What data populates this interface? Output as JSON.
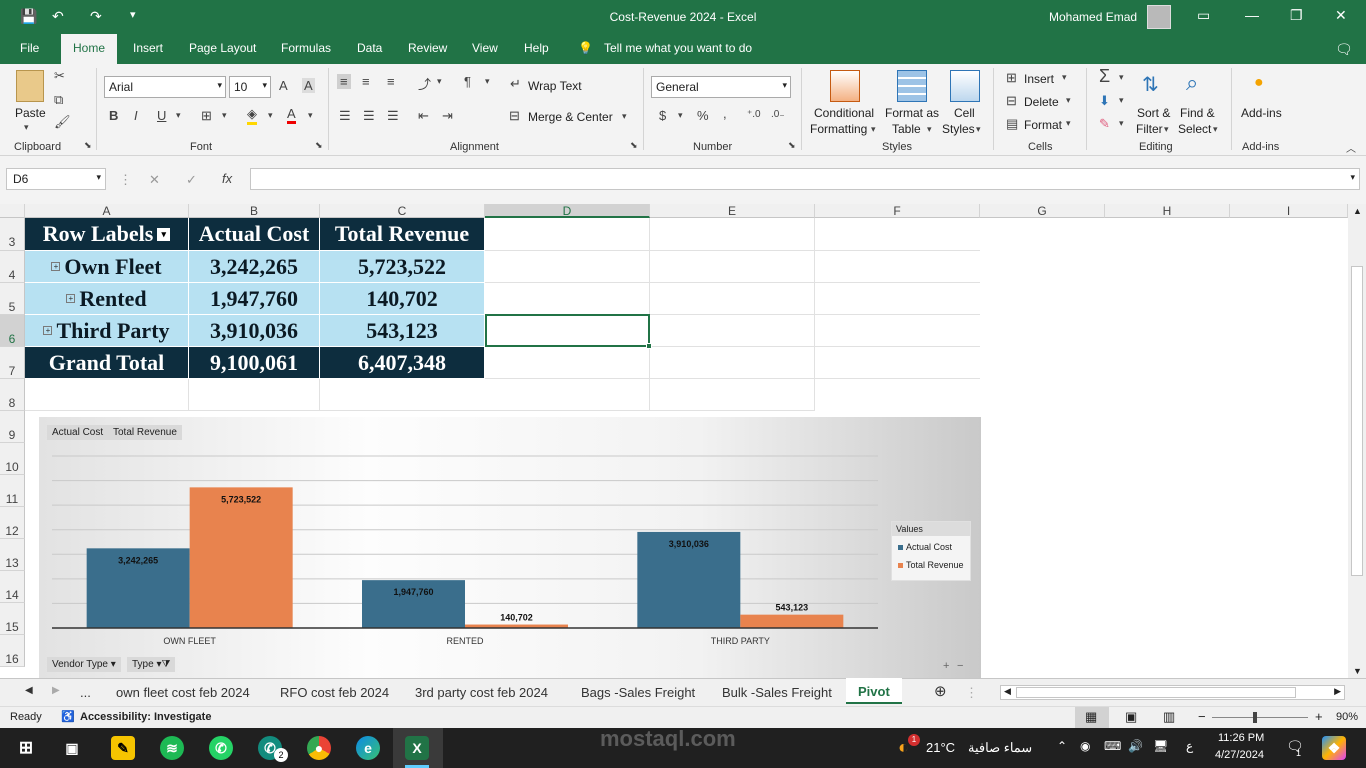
{
  "window": {
    "title": "Cost-Revenue 2024  -  Excel",
    "user_name": "Mohamed Emad"
  },
  "menu": {
    "tabs": [
      "File",
      "Home",
      "Insert",
      "Page Layout",
      "Formulas",
      "Data",
      "Review",
      "View",
      "Help"
    ],
    "active_tab": "Home",
    "tell_me": "Tell me what you want to do"
  },
  "ribbon": {
    "clipboard": {
      "paste": "Paste",
      "label": "Clipboard"
    },
    "font": {
      "name": "Arial",
      "size": "10",
      "label": "Font",
      "bold": "B",
      "italic": "I",
      "underline": "U"
    },
    "alignment": {
      "wrap_text": "Wrap Text",
      "merge_center": "Merge & Center",
      "label": "Alignment"
    },
    "number": {
      "format": "General",
      "label": "Number",
      "currency": "$",
      "percent": "%",
      "comma": ","
    },
    "styles": {
      "conditional_1": "Conditional",
      "conditional_2": "Formatting",
      "format_table_1": "Format as",
      "format_table_2": "Table",
      "cell_styles_1": "Cell",
      "cell_styles_2": "Styles",
      "label": "Styles"
    },
    "cells": {
      "insert": "Insert",
      "delete": "Delete",
      "format": "Format",
      "label": "Cells"
    },
    "editing": {
      "sort_1": "Sort &",
      "sort_2": "Filter",
      "find_1": "Find &",
      "find_2": "Select",
      "sum": "Σ",
      "label": "Editing"
    },
    "addins": {
      "button": "Add-ins",
      "label": "Add-ins"
    }
  },
  "formula_bar": {
    "name_box": "D6",
    "fx": "fx",
    "cancel": "✕",
    "enter": "✓",
    "formula": ""
  },
  "columns": [
    "A",
    "B",
    "C",
    "D",
    "E",
    "F",
    "G",
    "H",
    "I"
  ],
  "selected_column": "D",
  "rows": [
    "3",
    "4",
    "5",
    "6",
    "7",
    "8",
    "9",
    "10",
    "11",
    "12",
    "13",
    "14",
    "15",
    "16"
  ],
  "pivot": {
    "headers": [
      "Row Labels",
      "Actual Cost",
      "Total Revenue"
    ],
    "rows": [
      {
        "label": "Own Fleet",
        "cost": "3,242,265",
        "revenue": "5,723,522"
      },
      {
        "label": "Rented",
        "cost": "1,947,760",
        "revenue": "140,702"
      },
      {
        "label": "Third Party",
        "cost": "3,910,036",
        "revenue": "543,123"
      }
    ],
    "total": {
      "label": "Grand Total",
      "cost": "9,100,061",
      "revenue": "6,407,348"
    }
  },
  "chart_data": {
    "type": "bar",
    "categories": [
      "OWN FLEET",
      "RENTED",
      "THIRD PARTY"
    ],
    "series": [
      {
        "name": "Actual Cost",
        "values": [
          3242265,
          1947760,
          3910036
        ],
        "labels": [
          "3,242,265",
          "1,947,760",
          "3,910,036"
        ],
        "color": "#3a6e8c"
      },
      {
        "name": "Total Revenue",
        "values": [
          5723522,
          140702,
          543123
        ],
        "labels": [
          "5,723,522",
          "140,702",
          "543,123"
        ],
        "color": "#e8834e"
      }
    ],
    "ylim": [
      0,
      7000000
    ],
    "grid": true,
    "legend": {
      "title": "Values",
      "placement": "right"
    },
    "field_buttons": {
      "values": [
        "Actual Cost",
        "Total Revenue"
      ],
      "axis": [
        "Vendor Type",
        "Type"
      ]
    }
  },
  "sheets": {
    "tabs": [
      "...",
      "own fleet cost feb 2024",
      "RFO cost feb 2024",
      "3rd party cost feb 2024",
      "Bags -Sales Freight",
      "Bulk -Sales Freight",
      "Pivot"
    ],
    "active": "Pivot"
  },
  "status": {
    "mode": "Ready",
    "accessibility": "Accessibility: Investigate",
    "zoom": "90%"
  },
  "taskbar": {
    "weather_temp": "21°C",
    "weather_text": "سماء صافية",
    "time": "11:26 PM",
    "date": "4/27/2024",
    "lang": "ع",
    "notification_count": "1",
    "whatsapp_count": "2",
    "weather_badge": "1"
  },
  "watermark": "mostaql.com"
}
